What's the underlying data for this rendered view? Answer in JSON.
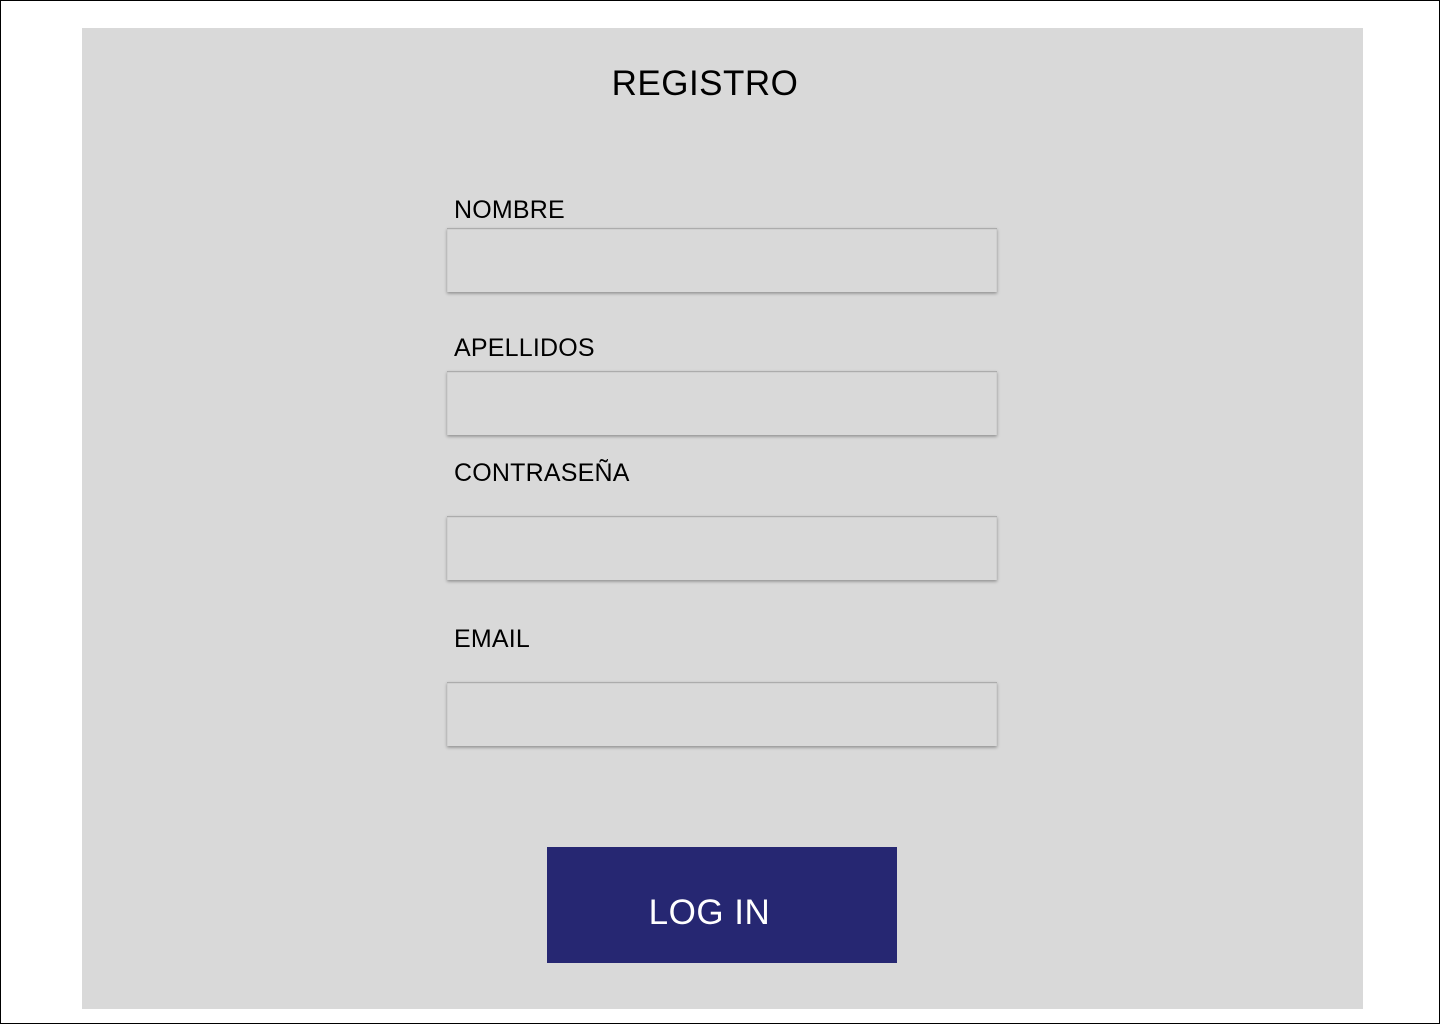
{
  "form": {
    "title": "REGISTRO",
    "fields": [
      {
        "label": "NOMBRE",
        "value": "",
        "placeholder": ""
      },
      {
        "label": "APELLIDOS",
        "value": "",
        "placeholder": ""
      },
      {
        "label": "CONTRASEÑA",
        "value": "",
        "placeholder": ""
      },
      {
        "label": "EMAIL",
        "value": "",
        "placeholder": ""
      }
    ],
    "submit_label": "LOG IN"
  },
  "colors": {
    "panel_background": "#d9d9d9",
    "button_background": "#262772",
    "button_text": "#ffffff",
    "text": "#000000"
  }
}
